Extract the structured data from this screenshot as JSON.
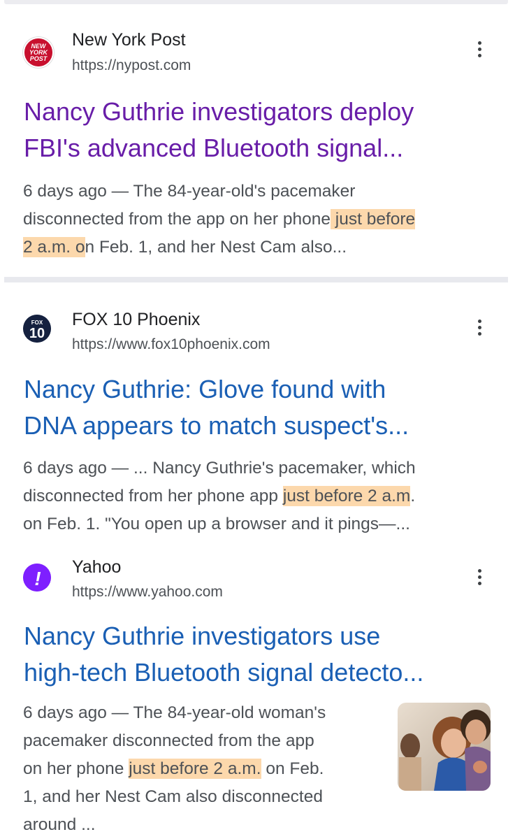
{
  "results": [
    {
      "source_name": "New York Post",
      "source_url": "https://nypost.com",
      "favicon": "new-york-post-logo",
      "favicon_lines": [
        "NEW",
        "YORK",
        "POST"
      ],
      "title_lines": [
        "Nancy Guthrie investigators deploy",
        "FBI's advanced Bluetooth signal..."
      ],
      "snippet": {
        "l1": "6 days ago — The 84-year-old's pacemaker",
        "l2_pre": "disconnected from the app on her phone",
        "l2_hl": " just before",
        "l3_hl": "2 a.m. o",
        "l3_post": "n Feb. 1, and her Nest Cam also..."
      }
    },
    {
      "source_name": "FOX 10 Phoenix",
      "source_url": "https://www.fox10phoenix.com",
      "favicon": "fox-10-logo",
      "favicon_top": "FOX",
      "favicon_num": "10",
      "title_lines": [
        "Nancy Guthrie: Glove found with",
        "DNA appears to match suspect's..."
      ],
      "snippet": {
        "l1": "6 days ago — ... Nancy Guthrie's pacemaker, which",
        "l2_pre": "disconnected from her phone app ",
        "l2_hl": "just before 2 a.m",
        "l2_post": ".",
        "l3": "on Feb. 1. \"You open up a browser and it pings—..."
      }
    },
    {
      "source_name": "Yahoo",
      "source_url": "https://www.yahoo.com",
      "favicon": "yahoo-exclamation-logo",
      "favicon_glyph": "!",
      "title_lines": [
        "Nancy Guthrie investigators use",
        "high-tech Bluetooth signal detecto..."
      ],
      "snippet": {
        "l1": "6 days ago — The 84-year-old woman's",
        "l2": "pacemaker disconnected from the app",
        "l3_pre": "on her phone ",
        "l3_hl": "just before 2 a.m.",
        "l3_post": " on Feb.",
        "l4": "1, and her Nest Cam also disconnected",
        "l5": "around ..."
      },
      "thumbnail": "photo-of-women-smiling"
    }
  ],
  "colors": {
    "visited_title": "#681da8",
    "link_title": "#1a5fb4",
    "highlight": "#fcd8ac",
    "snippet_text": "#4d5156"
  }
}
